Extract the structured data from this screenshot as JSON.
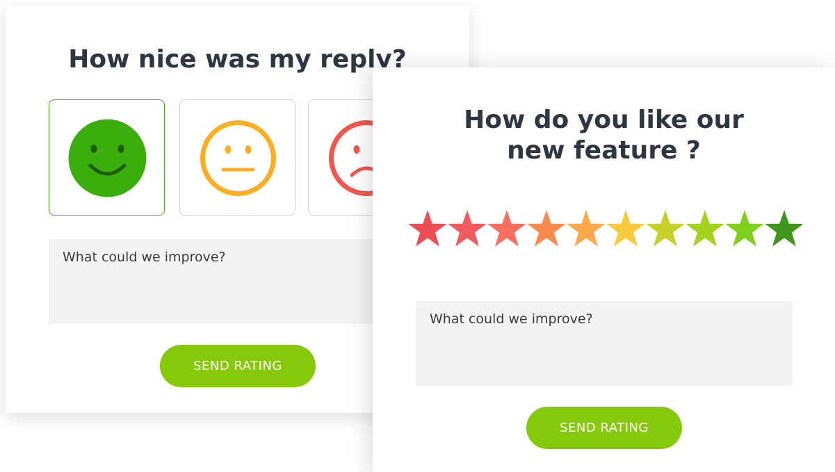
{
  "left_card": {
    "title": "How nice was my reply?",
    "faces": [
      {
        "name": "happy",
        "color": "#3aae0c",
        "selected": true
      },
      {
        "name": "neutral",
        "color": "#fcae23",
        "selected": false
      },
      {
        "name": "sad",
        "color": "#f2564d",
        "selected": false
      }
    ],
    "textarea_placeholder": "What could we improve?",
    "send_label": "SEND RATING"
  },
  "right_card": {
    "title_line1": "How do you like our",
    "title_line2": "new feature ?",
    "stars": {
      "count": 10,
      "colors": [
        "#ec4e56",
        "#f25b5e",
        "#f86f5f",
        "#fb8a4f",
        "#fda84b",
        "#fbc93c",
        "#c5d02a",
        "#a2d31d",
        "#7fcf1c",
        "#40961c"
      ]
    },
    "textarea_placeholder": "What could we improve?",
    "send_label": "SEND RATING"
  },
  "colors": {
    "accent": "#85c90a",
    "title": "#2d3642",
    "input_bg": "#f3f3f3"
  }
}
